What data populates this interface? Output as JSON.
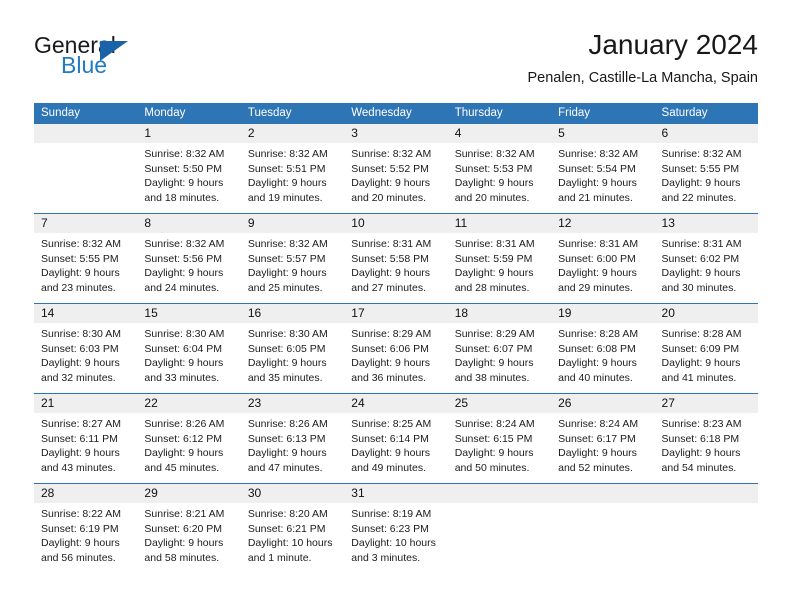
{
  "logo": {
    "word_top": "General",
    "word_bottom": "Blue",
    "triangle_color": "#1b63a8",
    "blue_color": "#1e7bc4"
  },
  "header": {
    "title": "January 2024",
    "subtitle": "Penalen, Castille-La Mancha, Spain"
  },
  "theme": {
    "header_blue": "#2e75b6",
    "row_band_gray": "#efefef",
    "text": "#1c1c1c"
  },
  "calendar": {
    "weekdays": [
      "Sunday",
      "Monday",
      "Tuesday",
      "Wednesday",
      "Thursday",
      "Friday",
      "Saturday"
    ],
    "weeks": [
      [
        {
          "day": "",
          "lines": []
        },
        {
          "day": "1",
          "lines": [
            "Sunrise: 8:32 AM",
            "Sunset: 5:50 PM",
            "Daylight: 9 hours",
            "and 18 minutes."
          ]
        },
        {
          "day": "2",
          "lines": [
            "Sunrise: 8:32 AM",
            "Sunset: 5:51 PM",
            "Daylight: 9 hours",
            "and 19 minutes."
          ]
        },
        {
          "day": "3",
          "lines": [
            "Sunrise: 8:32 AM",
            "Sunset: 5:52 PM",
            "Daylight: 9 hours",
            "and 20 minutes."
          ]
        },
        {
          "day": "4",
          "lines": [
            "Sunrise: 8:32 AM",
            "Sunset: 5:53 PM",
            "Daylight: 9 hours",
            "and 20 minutes."
          ]
        },
        {
          "day": "5",
          "lines": [
            "Sunrise: 8:32 AM",
            "Sunset: 5:54 PM",
            "Daylight: 9 hours",
            "and 21 minutes."
          ]
        },
        {
          "day": "6",
          "lines": [
            "Sunrise: 8:32 AM",
            "Sunset: 5:55 PM",
            "Daylight: 9 hours",
            "and 22 minutes."
          ]
        }
      ],
      [
        {
          "day": "7",
          "lines": [
            "Sunrise: 8:32 AM",
            "Sunset: 5:55 PM",
            "Daylight: 9 hours",
            "and 23 minutes."
          ]
        },
        {
          "day": "8",
          "lines": [
            "Sunrise: 8:32 AM",
            "Sunset: 5:56 PM",
            "Daylight: 9 hours",
            "and 24 minutes."
          ]
        },
        {
          "day": "9",
          "lines": [
            "Sunrise: 8:32 AM",
            "Sunset: 5:57 PM",
            "Daylight: 9 hours",
            "and 25 minutes."
          ]
        },
        {
          "day": "10",
          "lines": [
            "Sunrise: 8:31 AM",
            "Sunset: 5:58 PM",
            "Daylight: 9 hours",
            "and 27 minutes."
          ]
        },
        {
          "day": "11",
          "lines": [
            "Sunrise: 8:31 AM",
            "Sunset: 5:59 PM",
            "Daylight: 9 hours",
            "and 28 minutes."
          ]
        },
        {
          "day": "12",
          "lines": [
            "Sunrise: 8:31 AM",
            "Sunset: 6:00 PM",
            "Daylight: 9 hours",
            "and 29 minutes."
          ]
        },
        {
          "day": "13",
          "lines": [
            "Sunrise: 8:31 AM",
            "Sunset: 6:02 PM",
            "Daylight: 9 hours",
            "and 30 minutes."
          ]
        }
      ],
      [
        {
          "day": "14",
          "lines": [
            "Sunrise: 8:30 AM",
            "Sunset: 6:03 PM",
            "Daylight: 9 hours",
            "and 32 minutes."
          ]
        },
        {
          "day": "15",
          "lines": [
            "Sunrise: 8:30 AM",
            "Sunset: 6:04 PM",
            "Daylight: 9 hours",
            "and 33 minutes."
          ]
        },
        {
          "day": "16",
          "lines": [
            "Sunrise: 8:30 AM",
            "Sunset: 6:05 PM",
            "Daylight: 9 hours",
            "and 35 minutes."
          ]
        },
        {
          "day": "17",
          "lines": [
            "Sunrise: 8:29 AM",
            "Sunset: 6:06 PM",
            "Daylight: 9 hours",
            "and 36 minutes."
          ]
        },
        {
          "day": "18",
          "lines": [
            "Sunrise: 8:29 AM",
            "Sunset: 6:07 PM",
            "Daylight: 9 hours",
            "and 38 minutes."
          ]
        },
        {
          "day": "19",
          "lines": [
            "Sunrise: 8:28 AM",
            "Sunset: 6:08 PM",
            "Daylight: 9 hours",
            "and 40 minutes."
          ]
        },
        {
          "day": "20",
          "lines": [
            "Sunrise: 8:28 AM",
            "Sunset: 6:09 PM",
            "Daylight: 9 hours",
            "and 41 minutes."
          ]
        }
      ],
      [
        {
          "day": "21",
          "lines": [
            "Sunrise: 8:27 AM",
            "Sunset: 6:11 PM",
            "Daylight: 9 hours",
            "and 43 minutes."
          ]
        },
        {
          "day": "22",
          "lines": [
            "Sunrise: 8:26 AM",
            "Sunset: 6:12 PM",
            "Daylight: 9 hours",
            "and 45 minutes."
          ]
        },
        {
          "day": "23",
          "lines": [
            "Sunrise: 8:26 AM",
            "Sunset: 6:13 PM",
            "Daylight: 9 hours",
            "and 47 minutes."
          ]
        },
        {
          "day": "24",
          "lines": [
            "Sunrise: 8:25 AM",
            "Sunset: 6:14 PM",
            "Daylight: 9 hours",
            "and 49 minutes."
          ]
        },
        {
          "day": "25",
          "lines": [
            "Sunrise: 8:24 AM",
            "Sunset: 6:15 PM",
            "Daylight: 9 hours",
            "and 50 minutes."
          ]
        },
        {
          "day": "26",
          "lines": [
            "Sunrise: 8:24 AM",
            "Sunset: 6:17 PM",
            "Daylight: 9 hours",
            "and 52 minutes."
          ]
        },
        {
          "day": "27",
          "lines": [
            "Sunrise: 8:23 AM",
            "Sunset: 6:18 PM",
            "Daylight: 9 hours",
            "and 54 minutes."
          ]
        }
      ],
      [
        {
          "day": "28",
          "lines": [
            "Sunrise: 8:22 AM",
            "Sunset: 6:19 PM",
            "Daylight: 9 hours",
            "and 56 minutes."
          ]
        },
        {
          "day": "29",
          "lines": [
            "Sunrise: 8:21 AM",
            "Sunset: 6:20 PM",
            "Daylight: 9 hours",
            "and 58 minutes."
          ]
        },
        {
          "day": "30",
          "lines": [
            "Sunrise: 8:20 AM",
            "Sunset: 6:21 PM",
            "Daylight: 10 hours",
            "and 1 minute."
          ]
        },
        {
          "day": "31",
          "lines": [
            "Sunrise: 8:19 AM",
            "Sunset: 6:23 PM",
            "Daylight: 10 hours",
            "and 3 minutes."
          ]
        },
        {
          "day": "",
          "lines": []
        },
        {
          "day": "",
          "lines": []
        },
        {
          "day": "",
          "lines": []
        }
      ]
    ]
  }
}
